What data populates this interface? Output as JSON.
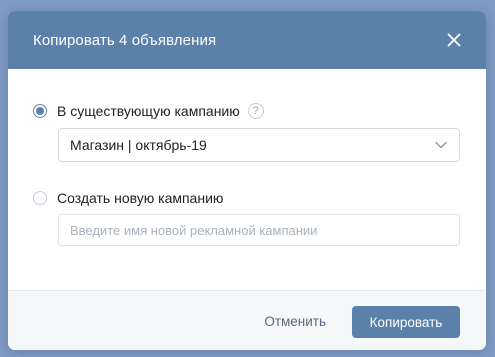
{
  "dialog": {
    "title": "Копировать 4 объявления",
    "close_icon": "close-icon"
  },
  "options": {
    "existing": {
      "label": "В существующую кампанию",
      "checked": true,
      "help_glyph": "?"
    },
    "new": {
      "label": "Создать новую кампанию",
      "checked": false
    }
  },
  "campaign_select": {
    "value": "Магазин | октябрь-19",
    "icon": "chevron-down-icon"
  },
  "new_campaign_input": {
    "placeholder": "Введите имя новой рекламной кампании",
    "value": ""
  },
  "footer": {
    "cancel_label": "Отменить",
    "copy_label": "Копировать"
  },
  "colors": {
    "header_bg": "#5b81ab",
    "accent": "#5e81a8",
    "backdrop": "#7f9cc6"
  }
}
